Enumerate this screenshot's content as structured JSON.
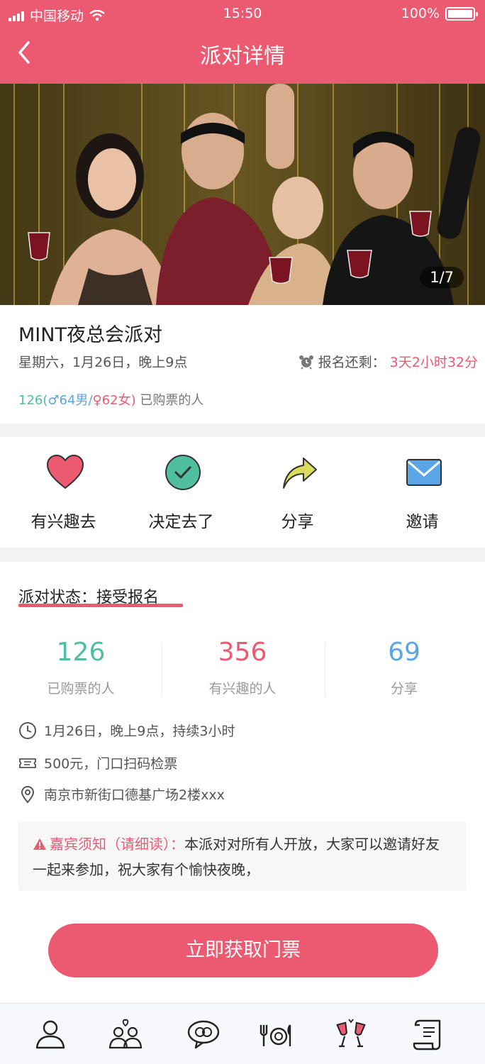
{
  "status_bar": {
    "carrier": "中国移动",
    "time": "15:50",
    "battery": "100%",
    "battery_level": 1.0
  },
  "nav": {
    "title": "派对详情",
    "back_icon": "chevron-left-icon"
  },
  "banner": {
    "page_indicator": "1/7",
    "current_page": 1,
    "total_pages": 7
  },
  "party": {
    "title": "MINT夜总会派对",
    "date": "星期六，1月26日，晚上9点",
    "countdown_label": "报名还剩：",
    "countdown_value": "3天2小时32分",
    "buyers_total": "126",
    "buyers_male": "64男",
    "buyers_female": "62女",
    "buyers_suffix": "已购票的人"
  },
  "actions": [
    {
      "label": "有兴趣去",
      "icon": "heart-icon"
    },
    {
      "label": "决定去了",
      "icon": "check-circle-icon"
    },
    {
      "label": "分享",
      "icon": "share-arrow-icon"
    },
    {
      "label": "邀请",
      "icon": "envelope-icon"
    }
  ],
  "details": {
    "status_label": "派对状态：",
    "status_value": "接受报名",
    "stats": [
      {
        "value": "126",
        "label": "已购票的人",
        "color": "#4fbf9f"
      },
      {
        "value": "356",
        "label": "有兴趣的人",
        "color": "#ec5a72"
      },
      {
        "value": "69",
        "label": "分享",
        "color": "#5aa5e6"
      }
    ],
    "time_text": "1月26日，晚上9点，持续3小时",
    "price_text": "500元，门口扫码检票",
    "address_text": "南京市新街口德基广场2楼xxx",
    "notice_label": "嘉宾须知（请细读）：",
    "notice_text": "本派对对所有人开放，大家可以邀请好友一起来参加，祝大家有个愉快夜晚，",
    "cta_label": "立即获取门票"
  },
  "tabbar": {
    "items": [
      "profile-icon",
      "couple-icon",
      "chat-icon",
      "dining-icon",
      "toast-icon",
      "scroll-icon"
    ]
  },
  "colors": {
    "accent": "#ec5a72",
    "green": "#4fbf9f",
    "blue": "#5aa5e6"
  }
}
